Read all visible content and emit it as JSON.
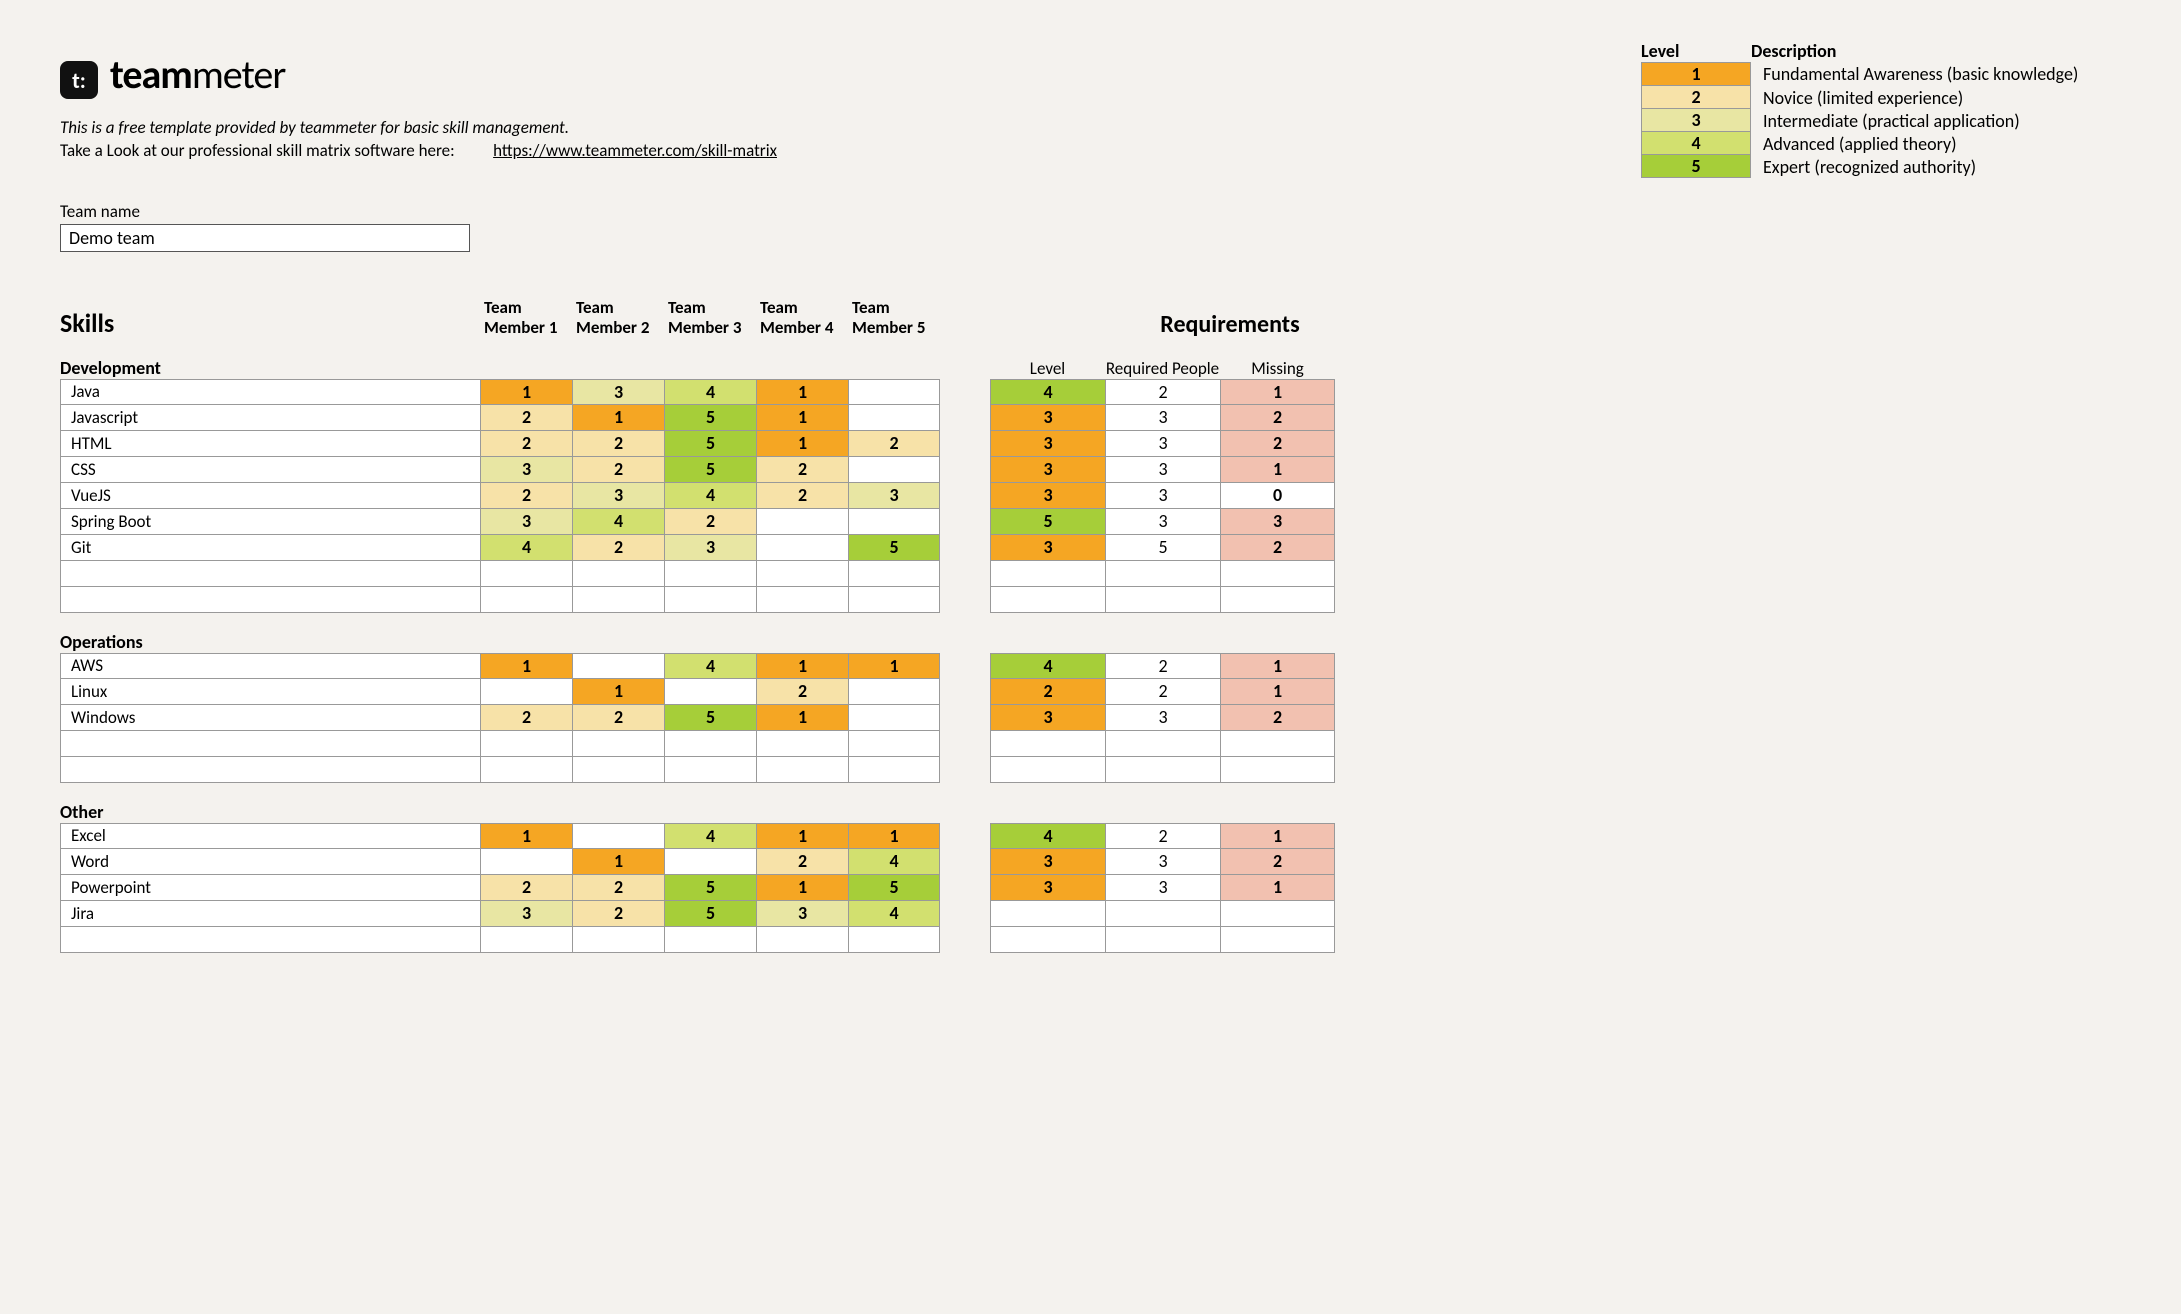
{
  "brand_bold": "team",
  "brand_light": "meter",
  "subtitle": "This is a free template provided by teammeter for basic skill management.",
  "tagline_text": "Take a Look at our professional skill matrix software here:",
  "tagline_url": "https://www.teammeter.com/skill-matrix",
  "legend_header_level": "Level",
  "legend_header_desc": "Description",
  "legend": [
    {
      "level": "1",
      "desc": "Fundamental Awareness (basic knowledge)",
      "cls": "c1"
    },
    {
      "level": "2",
      "desc": "Novice (limited experience)",
      "cls": "c2"
    },
    {
      "level": "3",
      "desc": "Intermediate (practical application)",
      "cls": "c3"
    },
    {
      "level": "4",
      "desc": "Advanced (applied theory)",
      "cls": "c4"
    },
    {
      "level": "5",
      "desc": "Expert (recognized authority)",
      "cls": "c5"
    }
  ],
  "team_name_label": "Team name",
  "team_name_value": "Demo team",
  "skills_title": "Skills",
  "requirements_title": "Requirements",
  "members": [
    "Team Member 1",
    "Team Member 2",
    "Team Member 3",
    "Team Member 4",
    "Team Member 5"
  ],
  "req_headers": [
    "Level",
    "Required People",
    "Missing"
  ],
  "sections": [
    {
      "name": "Development",
      "rows": [
        {
          "skill": "Java",
          "levels": [
            "1",
            "3",
            "4",
            "1",
            ""
          ],
          "req": [
            "4",
            "2",
            "1"
          ]
        },
        {
          "skill": "Javascript",
          "levels": [
            "2",
            "1",
            "5",
            "1",
            ""
          ],
          "req": [
            "3",
            "3",
            "2"
          ]
        },
        {
          "skill": "HTML",
          "levels": [
            "2",
            "2",
            "5",
            "1",
            "2"
          ],
          "req": [
            "3",
            "3",
            "2"
          ]
        },
        {
          "skill": "CSS",
          "levels": [
            "3",
            "2",
            "5",
            "2",
            ""
          ],
          "req": [
            "3",
            "3",
            "1"
          ]
        },
        {
          "skill": "VueJS",
          "levels": [
            "2",
            "3",
            "4",
            "2",
            "3"
          ],
          "req": [
            "3",
            "3",
            "0"
          ]
        },
        {
          "skill": "Spring Boot",
          "levels": [
            "3",
            "4",
            "2",
            "",
            ""
          ],
          "req": [
            "5",
            "3",
            "3"
          ]
        },
        {
          "skill": "Git",
          "levels": [
            "4",
            "2",
            "3",
            "",
            "5"
          ],
          "req": [
            "3",
            "5",
            "2"
          ]
        },
        {
          "skill": "",
          "levels": [
            "",
            "",
            "",
            "",
            ""
          ],
          "req": [
            "",
            "",
            ""
          ]
        },
        {
          "skill": "",
          "levels": [
            "",
            "",
            "",
            "",
            ""
          ],
          "req": [
            "",
            "",
            ""
          ]
        }
      ]
    },
    {
      "name": "Operations",
      "rows": [
        {
          "skill": "AWS",
          "levels": [
            "1",
            "",
            "4",
            "1",
            "1"
          ],
          "req": [
            "4",
            "2",
            "1"
          ]
        },
        {
          "skill": "Linux",
          "levels": [
            "",
            "1",
            "",
            "2",
            ""
          ],
          "req": [
            "2",
            "2",
            "1"
          ]
        },
        {
          "skill": "Windows",
          "levels": [
            "2",
            "2",
            "5",
            "1",
            ""
          ],
          "req": [
            "3",
            "3",
            "2"
          ]
        },
        {
          "skill": "",
          "levels": [
            "",
            "",
            "",
            "",
            ""
          ],
          "req": [
            "",
            "",
            ""
          ]
        },
        {
          "skill": "",
          "levels": [
            "",
            "",
            "",
            "",
            ""
          ],
          "req": [
            "",
            "",
            ""
          ]
        }
      ]
    },
    {
      "name": "Other",
      "rows": [
        {
          "skill": "Excel",
          "levels": [
            "1",
            "",
            "4",
            "1",
            "1"
          ],
          "req": [
            "4",
            "2",
            "1"
          ]
        },
        {
          "skill": "Word",
          "levels": [
            "",
            "1",
            "",
            "2",
            "4"
          ],
          "req": [
            "3",
            "3",
            "2"
          ]
        },
        {
          "skill": "Powerpoint",
          "levels": [
            "2",
            "2",
            "5",
            "1",
            "5"
          ],
          "req": [
            "3",
            "3",
            "1"
          ]
        },
        {
          "skill": "Jira",
          "levels": [
            "3",
            "2",
            "5",
            "3",
            "4"
          ],
          "req": [
            "",
            "",
            ""
          ]
        },
        {
          "skill": "",
          "levels": [
            "",
            "",
            "",
            "",
            ""
          ],
          "req": [
            "",
            "",
            ""
          ]
        }
      ]
    }
  ]
}
